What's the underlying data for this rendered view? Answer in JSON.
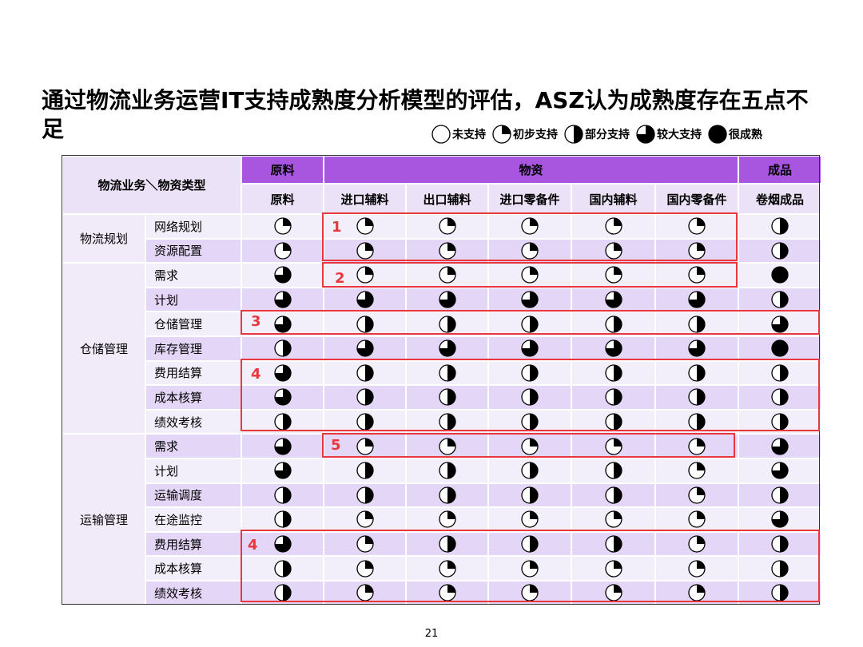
{
  "title": "通过物流业务运营IT支持成熟度分析模型的评估，ASZ认为成熟度存在五点不足",
  "legend": [
    {
      "level": 0,
      "label": "未支持"
    },
    {
      "level": 1,
      "label": "初步支持"
    },
    {
      "level": 2,
      "label": "部分支持"
    },
    {
      "level": 3,
      "label": "较大支持"
    },
    {
      "level": 4,
      "label": "很成熟"
    }
  ],
  "table": {
    "corner_label": "物流业务＼物资类型",
    "group_headers": [
      "原料",
      "物资",
      "成品"
    ],
    "columns": [
      "原料",
      "进口辅料",
      "出口辅料",
      "进口零备件",
      "国内辅料",
      "国内零备件",
      "卷烟成品"
    ],
    "categories": [
      {
        "name": "物流规划",
        "rows": [
          {
            "name": "网络规划",
            "levels": [
              1,
              1,
              1,
              1,
              1,
              1,
              2
            ]
          },
          {
            "name": "资源配置",
            "levels": [
              1,
              1,
              1,
              1,
              1,
              1,
              2
            ]
          }
        ]
      },
      {
        "name": "仓储管理",
        "rows": [
          {
            "name": "需求",
            "levels": [
              3,
              1,
              1,
              1,
              1,
              1,
              4
            ]
          },
          {
            "name": "计划",
            "levels": [
              3,
              3,
              3,
              3,
              3,
              3,
              2
            ]
          },
          {
            "name": "仓储管理",
            "levels": [
              3,
              2,
              2,
              2,
              2,
              2,
              3
            ]
          },
          {
            "name": "库存管理",
            "levels": [
              2,
              3,
              3,
              3,
              3,
              3,
              4
            ]
          },
          {
            "name": "费用结算",
            "levels": [
              3,
              2,
              2,
              2,
              2,
              2,
              2
            ]
          },
          {
            "name": "成本核算",
            "levels": [
              3,
              2,
              2,
              2,
              2,
              2,
              2
            ]
          },
          {
            "name": "绩效考核",
            "levels": [
              2,
              2,
              2,
              2,
              2,
              2,
              2
            ]
          }
        ]
      },
      {
        "name": "运输管理",
        "rows": [
          {
            "name": "需求",
            "levels": [
              3,
              1,
              1,
              1,
              1,
              1,
              3
            ]
          },
          {
            "name": "计划",
            "levels": [
              3,
              2,
              2,
              2,
              2,
              1,
              3
            ]
          },
          {
            "name": "运输调度",
            "levels": [
              2,
              2,
              2,
              2,
              2,
              1,
              2
            ]
          },
          {
            "name": "在途监控",
            "levels": [
              2,
              1,
              1,
              1,
              1,
              1,
              3
            ]
          },
          {
            "name": "费用结算",
            "levels": [
              3,
              1,
              2,
              2,
              2,
              1,
              2
            ]
          },
          {
            "name": "成本核算",
            "levels": [
              2,
              1,
              1,
              1,
              1,
              1,
              2
            ]
          },
          {
            "name": "绩效考核",
            "levels": [
              2,
              1,
              1,
              1,
              1,
              1,
              2
            ]
          }
        ]
      }
    ]
  },
  "highlights": [
    {
      "number": "1"
    },
    {
      "number": "2"
    },
    {
      "number": "3"
    },
    {
      "number": "4"
    },
    {
      "number": "5"
    },
    {
      "number": "4"
    }
  ],
  "colors": {
    "header_purple": "#a855e0",
    "highlight_red": "#e8383d"
  },
  "page_number": "21"
}
